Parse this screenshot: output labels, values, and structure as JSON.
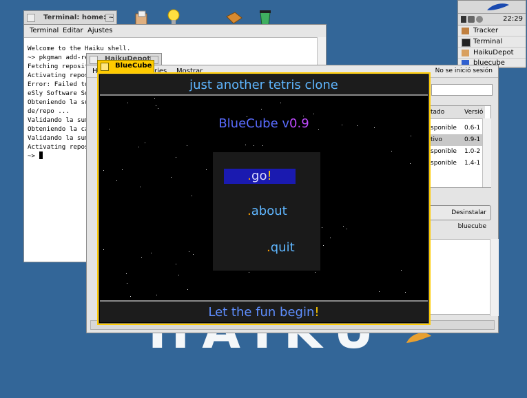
{
  "desktop": {
    "logo_text": "HAIKU",
    "icons": [
      "package-icon",
      "lightbulb-icon",
      "folder-icon",
      "trash-icon"
    ]
  },
  "deskbar": {
    "clock": "22:29",
    "items": [
      {
        "label": "Tracker",
        "icon": "tracker-icon"
      },
      {
        "label": "Terminal",
        "icon": "terminal-icon"
      },
      {
        "label": "HaikuDepot",
        "icon": "haikudepot-icon"
      },
      {
        "label": "bluecube",
        "icon": "bluecube-icon"
      }
    ]
  },
  "terminal": {
    "title": "Terminal: home: ~",
    "menu": [
      "Terminal",
      "Editar",
      "Ajustes"
    ],
    "lines": [
      "Welcome to the Haiku shell.",
      "",
      "~> pkgman add-re",
      "Fetching reposit",
      "Activating repos",
      "Error: Failed to",
      "eSly Software So",
      "Obteniendo la su",
      "de/repo ...",
      "Validando la sum",
      "Obteniendo la ca",
      "Validando la sum",
      "Activating repos",
      "~> "
    ]
  },
  "haikudepot": {
    "title": "HaikuDepot",
    "menu_visible": [
      "H",
      "ries",
      "Mostrar"
    ],
    "session": "No se inició sesión",
    "columns": [
      "tado",
      "Versió"
    ],
    "rows": [
      {
        "status": "sponible",
        "version": "0.6-1"
      },
      {
        "status": "tivo",
        "version": "0.9-1"
      },
      {
        "status": "sponible",
        "version": "1.0-2"
      },
      {
        "status": "sponible",
        "version": "1.4-1"
      }
    ],
    "uninstall_label": "Desinstalar bluecube"
  },
  "bluecube": {
    "title": "BlueCube",
    "header": "just another tetris clone",
    "game_title_main": "BlueCube v",
    "game_title_version": "0.9",
    "menu": {
      "go": {
        "dot": ".",
        "word": "go",
        "bang": "!"
      },
      "about": {
        "dot": ".",
        "word": "about"
      },
      "quit": {
        "dot": ".",
        "word": "quit"
      }
    },
    "footer_main": "Let the fun begin",
    "footer_bang": "!"
  },
  "colors": {
    "desktop": "#336698",
    "window_tab_active": "#ffcb00",
    "game_text": "#5fb6ff",
    "game_title": "#5a6cff",
    "game_version": "#c04aff",
    "selection": "#1a1ab0"
  }
}
